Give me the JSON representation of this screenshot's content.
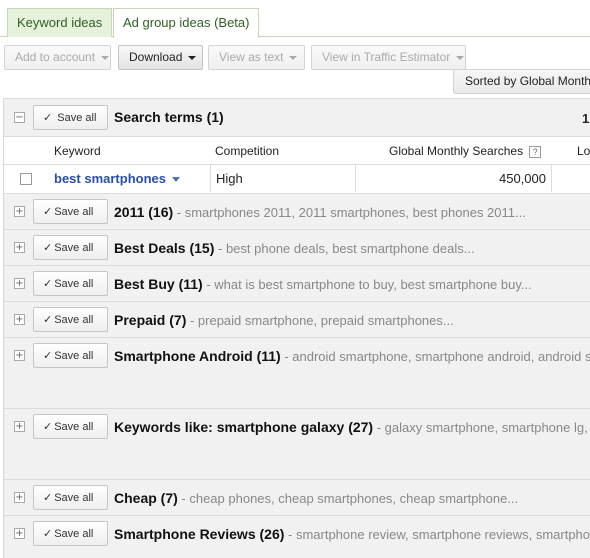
{
  "tabs": [
    {
      "label": "Keyword ideas",
      "active": false
    },
    {
      "label": "Ad group ideas (Beta)",
      "active": true
    }
  ],
  "toolbar": {
    "add_to_account": "Add to account",
    "download": "Download",
    "view_as_text": "View as text",
    "view_in_traffic_estimator": "View in Traffic Estimator",
    "sorted_by": "Sorted by Global Monthly S"
  },
  "search_terms": {
    "expander": "−",
    "save_all": "Save all",
    "title": "Search terms (1)",
    "right_count": "1",
    "columns": {
      "keyword": "Keyword",
      "competition": "Competition",
      "global_monthly_searches": "Global Monthly Searches",
      "help": "?",
      "local": "Lo"
    },
    "row": {
      "keyword": "best smartphones",
      "competition": "High",
      "global_monthly_searches": "450,000"
    }
  },
  "groups": [
    {
      "title": "2011 (16)",
      "keywords": " - smartphones 2011, 2011 smartphones, best phones 2011..."
    },
    {
      "title": "Best Deals (15)",
      "keywords": " - best phone deals, best smartphone deals..."
    },
    {
      "title": "Best Buy (11)",
      "keywords": " - what is best smartphone to buy, best smartphone buy..."
    },
    {
      "title": "Prepaid (7)",
      "keywords": " - prepaid smartphone, prepaid smartphones..."
    },
    {
      "title": "Smartphone Android (11)",
      "keywords": " - android smartphone, smartphone android, android sm"
    },
    {
      "title": "Keywords like: smartphone galaxy (27)",
      "keywords": " - galaxy smartphone, smartphone lg, lg"
    },
    {
      "title": "Cheap (7)",
      "keywords": " - cheap phones, cheap smartphones, cheap smartphone..."
    },
    {
      "title": "Smartphone Reviews (26)",
      "keywords": " - smartphone review, smartphone reviews, smartphone"
    }
  ],
  "group_expander": "+",
  "group_save_all": "Save all",
  "checkmark": "✓"
}
